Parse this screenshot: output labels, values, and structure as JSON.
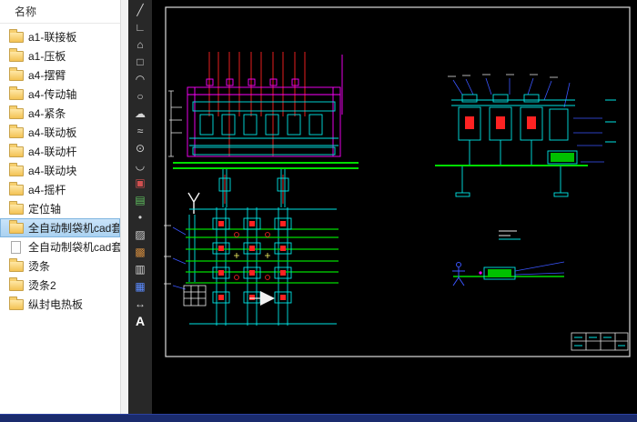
{
  "file_panel": {
    "header": "名称",
    "items": [
      {
        "label": "a1-联接板",
        "icon": "folder",
        "selected": false
      },
      {
        "label": "a1-压板",
        "icon": "folder",
        "selected": false
      },
      {
        "label": "a4-摆臂",
        "icon": "folder",
        "selected": false
      },
      {
        "label": "a4-传动轴",
        "icon": "folder",
        "selected": false
      },
      {
        "label": "a4-紧条",
        "icon": "folder",
        "selected": false
      },
      {
        "label": "a4-联动板",
        "icon": "folder",
        "selected": false
      },
      {
        "label": "a4-联动杆",
        "icon": "folder",
        "selected": false
      },
      {
        "label": "a4-联动块",
        "icon": "folder",
        "selected": false
      },
      {
        "label": "a4-摇杆",
        "icon": "folder",
        "selected": false
      },
      {
        "label": "定位轴",
        "icon": "folder",
        "selected": false
      },
      {
        "label": "全自动制袋机cad套",
        "icon": "folder",
        "selected": true
      },
      {
        "label": "全自动制袋机cad套",
        "icon": "file",
        "selected": false
      },
      {
        "label": "烫条",
        "icon": "folder",
        "selected": false
      },
      {
        "label": "烫条2",
        "icon": "folder",
        "selected": false
      },
      {
        "label": "纵封电热板",
        "icon": "folder",
        "selected": false
      }
    ]
  },
  "toolbar": {
    "tools": [
      {
        "name": "line",
        "glyph": "╱"
      },
      {
        "name": "polyline",
        "glyph": "∟"
      },
      {
        "name": "polygon",
        "glyph": "⌂"
      },
      {
        "name": "rectangle",
        "glyph": "□"
      },
      {
        "name": "arc",
        "glyph": "◠"
      },
      {
        "name": "circle",
        "glyph": "○"
      },
      {
        "name": "revision-cloud",
        "glyph": "☁"
      },
      {
        "name": "spline",
        "glyph": "≈"
      },
      {
        "name": "ellipse",
        "glyph": "⊙"
      },
      {
        "name": "ellipse-arc",
        "glyph": "◡"
      },
      {
        "name": "insert-block",
        "glyph": "▣"
      },
      {
        "name": "make-block",
        "glyph": "▤"
      },
      {
        "name": "point",
        "glyph": "•"
      },
      {
        "name": "hatch",
        "glyph": "▨"
      },
      {
        "name": "gradient",
        "glyph": "▩"
      },
      {
        "name": "region",
        "glyph": "▥"
      },
      {
        "name": "table",
        "glyph": "▦"
      },
      {
        "name": "dimension",
        "glyph": "↔"
      },
      {
        "name": "mtext",
        "glyph": "A"
      }
    ]
  },
  "canvas": {
    "background": "#000000",
    "line_colors": {
      "cyan": "#00e5e5",
      "magenta": "#ff00ff",
      "green": "#00dd00",
      "red": "#ff2222",
      "blue": "#3a55ff",
      "white": "#ededed"
    }
  }
}
